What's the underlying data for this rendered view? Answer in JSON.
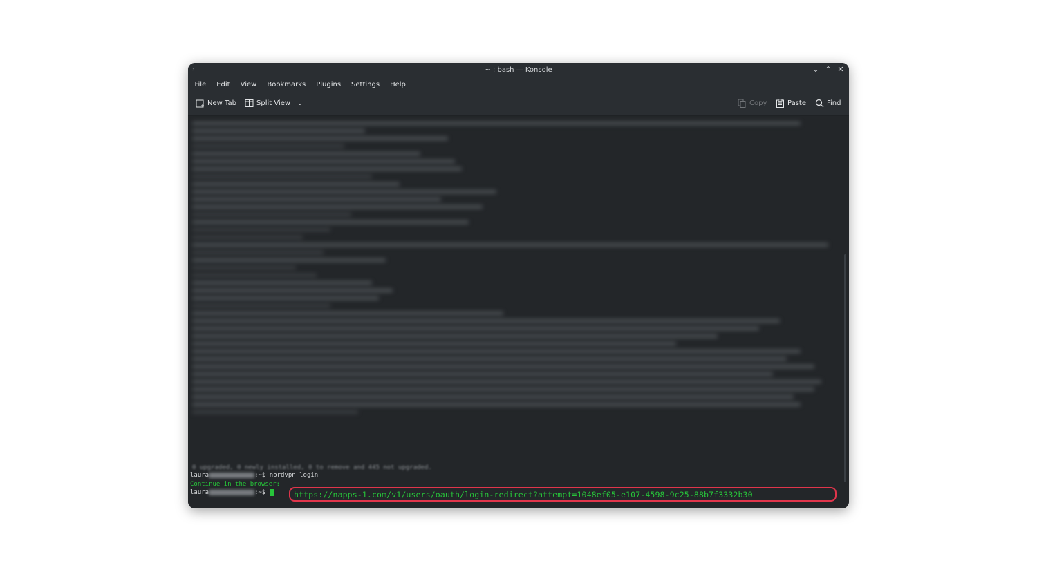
{
  "window": {
    "title": "~ : bash — Konsole",
    "controls": [
      "minimize",
      "maximize",
      "close"
    ]
  },
  "menubar": {
    "items": [
      "File",
      "Edit",
      "View",
      "Bookmarks",
      "Plugins",
      "Settings",
      "Help"
    ]
  },
  "toolbar": {
    "new_tab": "New Tab",
    "split_view": "Split View",
    "copy": "Copy",
    "paste": "Paste",
    "find": "Find"
  },
  "terminal": {
    "faded_line": "0 upgraded, 0 newly installed, 0 to remove and 445 not upgraded.",
    "prompt_user": "laura",
    "prompt_suffix": ":~$",
    "command": "nordvpn login",
    "continue_label": "Continue in the browser:",
    "url": "https://napps-1.com/v1/users/oauth/login-redirect?attempt=1048ef05-e107-4598-9c25-88b7f3332b30",
    "highlight_color": "#e0354b",
    "text_color_green": "#27c43a"
  }
}
